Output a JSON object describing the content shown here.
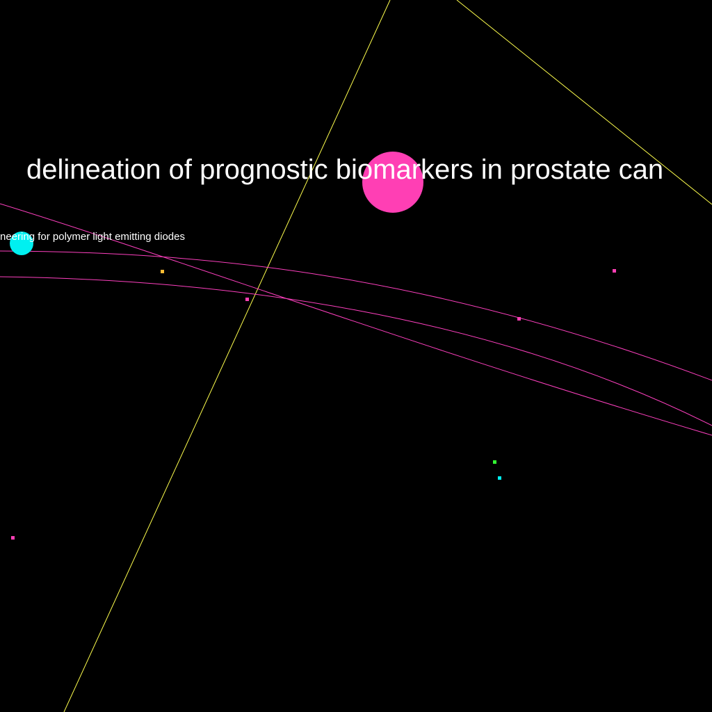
{
  "graph": {
    "background_color": "#000000",
    "labels": {
      "main_topic": "delineation of prognostic biomarkers in prostate can",
      "secondary_topic": "neering for polymer light emitting diodes"
    },
    "colors": {
      "pink": "#ff3fb4",
      "cyan": "#00f0f0",
      "yellow": "#ffff33",
      "green": "#33ff33",
      "orange": "#ffbb33",
      "yellow_line": "#ffff4d",
      "pink_line": "#ff40c0",
      "label": "#ffffff"
    }
  }
}
